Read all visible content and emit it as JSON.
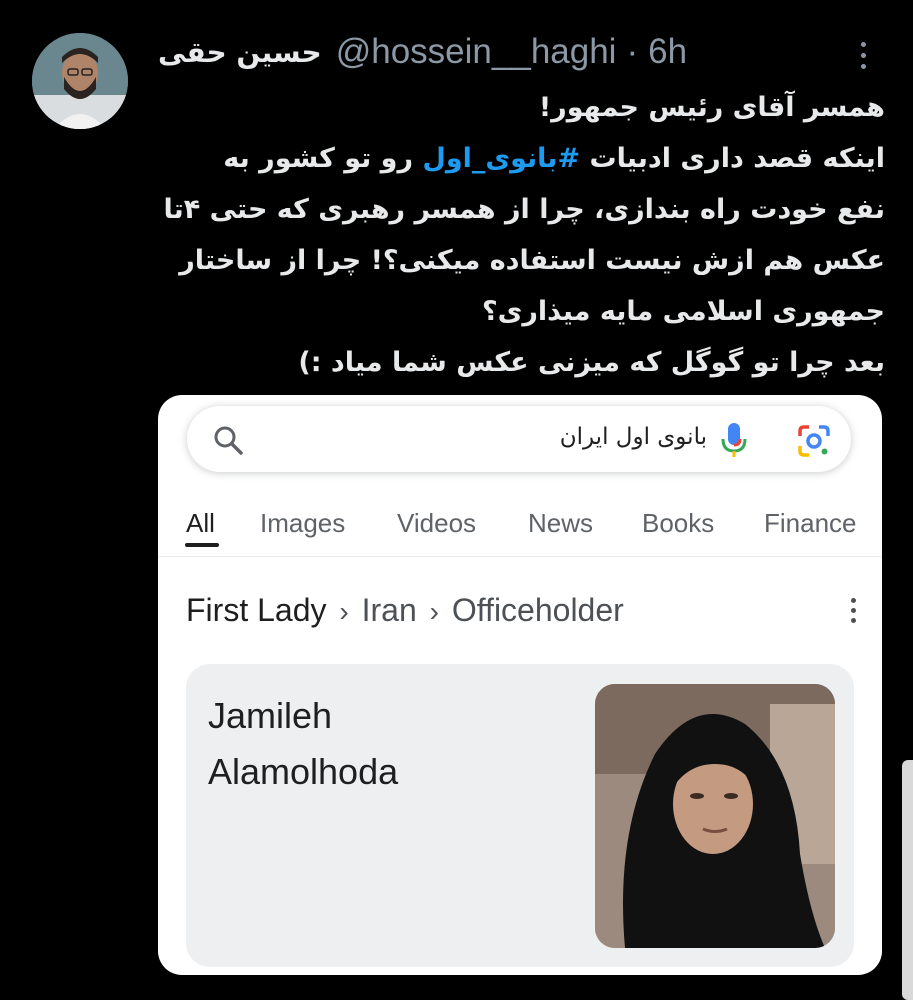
{
  "tweet": {
    "author_name": "حسین حقی",
    "handle": "@hossein__haghi",
    "separator": "·",
    "time": "6h",
    "lines": {
      "l1": "همسر آقای رئیس جمهور!",
      "l2_pre": "اینکه قصد داری ادبیات ",
      "l2_hashtag": "#بانوی_اول",
      "l2_post": " رو تو کشور به",
      "l3": "نفع خودت راه بندازی، چرا از همسر رهبری که حتی ۴تا",
      "l4": "عکس هم ازش نیست استفاده میکنی؟! چرا از ساختار",
      "l5": "جمهوری اسلامی مایه میذاری؟",
      "l6": "بعد چرا تو گوگل که میزنی عکس شما میاد :)"
    }
  },
  "google": {
    "search_query": "بانوی اول ایران",
    "tabs": [
      "All",
      "Images",
      "Videos",
      "News",
      "Books",
      "Finance"
    ],
    "breadcrumb": [
      "First Lady",
      "Iran",
      "Officeholder"
    ],
    "breadcrumb_sep": "›",
    "result": {
      "line1": "Jamileh",
      "line2": "Alamolhoda"
    }
  },
  "icons": [
    "more-icon",
    "search-icon",
    "mic-icon",
    "lens-icon",
    "kebab-icon"
  ],
  "colors": {
    "hashtag": "#1d9bf0",
    "muted": "#8b98a5",
    "bg": "#000000"
  }
}
